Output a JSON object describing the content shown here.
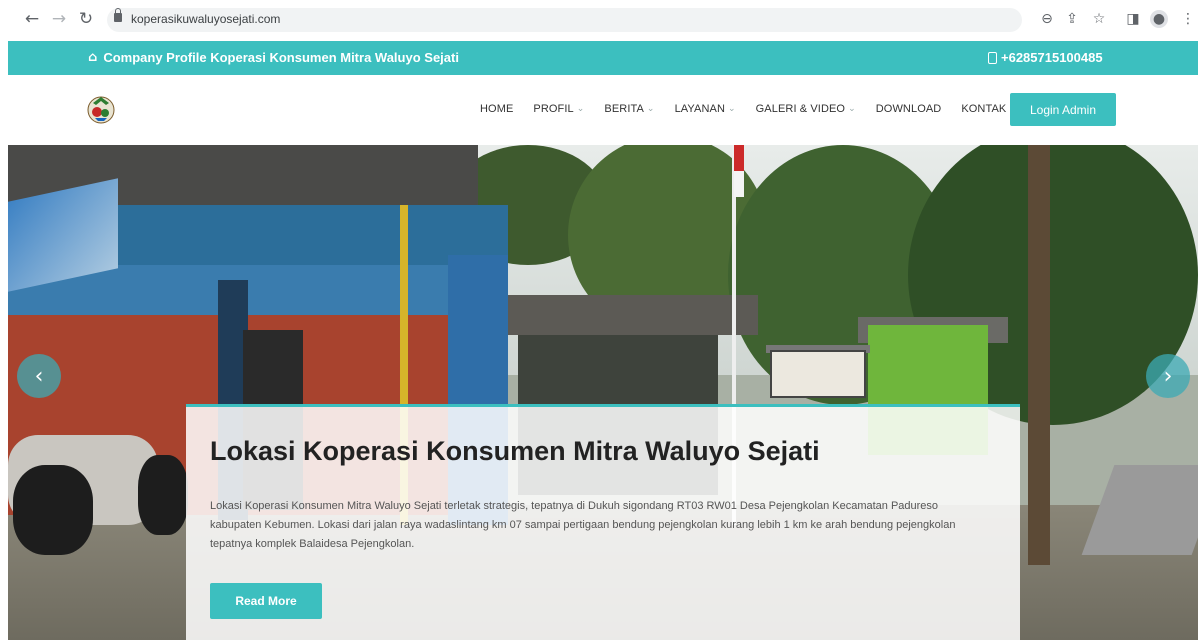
{
  "browser": {
    "url": "koperasikuwaluyosejati.com",
    "back_icon": "back-arrow-icon",
    "forward_icon": "forward-arrow-icon",
    "reload_icon": "reload-icon"
  },
  "topbar": {
    "title": "Company Profile Koperasi Konsumen Mitra Waluyo Sejati",
    "phone": "+6285715100485"
  },
  "nav": {
    "items": [
      {
        "label": "HOME",
        "dropdown": false
      },
      {
        "label": "PROFIL",
        "dropdown": true
      },
      {
        "label": "BERITA",
        "dropdown": true
      },
      {
        "label": "LAYANAN",
        "dropdown": true
      },
      {
        "label": "GALERI & VIDEO",
        "dropdown": true
      },
      {
        "label": "DOWNLOAD",
        "dropdown": false
      },
      {
        "label": "KONTAK",
        "dropdown": false
      }
    ],
    "login_label": "Login Admin"
  },
  "hero": {
    "title": "Lokasi Koperasi Konsumen Mitra Waluyo Sejati",
    "text": "Lokasi Koperasi Konsumen Mitra Waluyo Sejati terletak strategis, tepatnya di Dukuh sigondang RT03 RW01 Desa Pejengkolan Kecamatan Padureso kabupaten Kebumen. Lokasi dari jalan raya wadaslintang km 07 sampai pertigaan bendung pejengkolan kurang lebih 1 km ke arah bendung pejengkolan tepatnya komplek Balaidesa Pejengkolan.",
    "button": "Read More"
  },
  "colors": {
    "accent": "#3cbfbf"
  }
}
